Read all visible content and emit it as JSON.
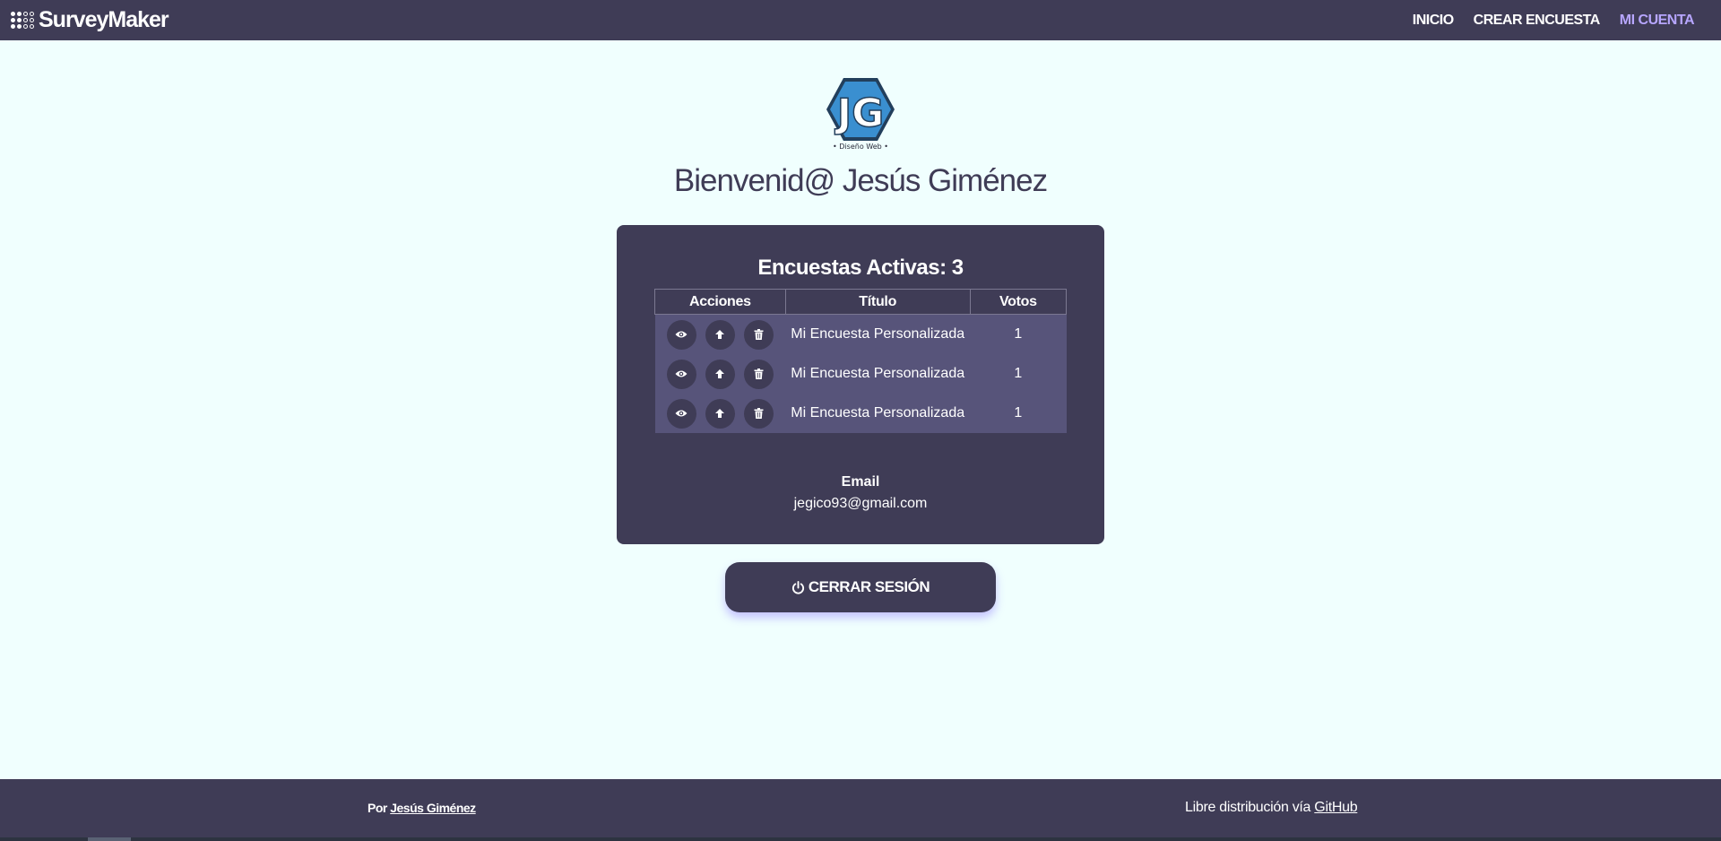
{
  "navbar": {
    "brand": "SurveyMaker",
    "links": [
      {
        "label": "INICIO"
      },
      {
        "label": "CREAR ENCUESTA"
      },
      {
        "label": "MI CUENTA",
        "active": true
      }
    ]
  },
  "logo": {
    "letters": "JG",
    "caption": "• Diseño Web •"
  },
  "welcome": "Bienvenid@ Jesús Giménez",
  "surveys": {
    "title": "Encuestas Activas: 3",
    "headers": [
      "Acciones",
      "Título",
      "Votos"
    ],
    "action_icons": [
      "eye-icon",
      "arrow-up-icon",
      "trash-icon"
    ],
    "rows": [
      {
        "title": "Mi Encuesta Personalizada",
        "votes": "1"
      },
      {
        "title": "Mi Encuesta Personalizada",
        "votes": "1"
      },
      {
        "title": "Mi Encuesta Personalizada",
        "votes": "1"
      }
    ]
  },
  "account": {
    "email_label": "Email",
    "email": "jegico93@gmail.com"
  },
  "logout": {
    "label": "CERRAR SESIÓN",
    "icon": "power-icon"
  },
  "footer": {
    "left_prefix": "Por ",
    "left_link": "Jesús Giménez",
    "right_prefix": "Libre distribución vía ",
    "right_link": "GitHub"
  },
  "colors": {
    "primary": "#3f3c56",
    "background": "#f0fffe",
    "accent": "#b7a6ff",
    "table_row": "#57547a",
    "logo_blue": "#3a8fd0"
  }
}
